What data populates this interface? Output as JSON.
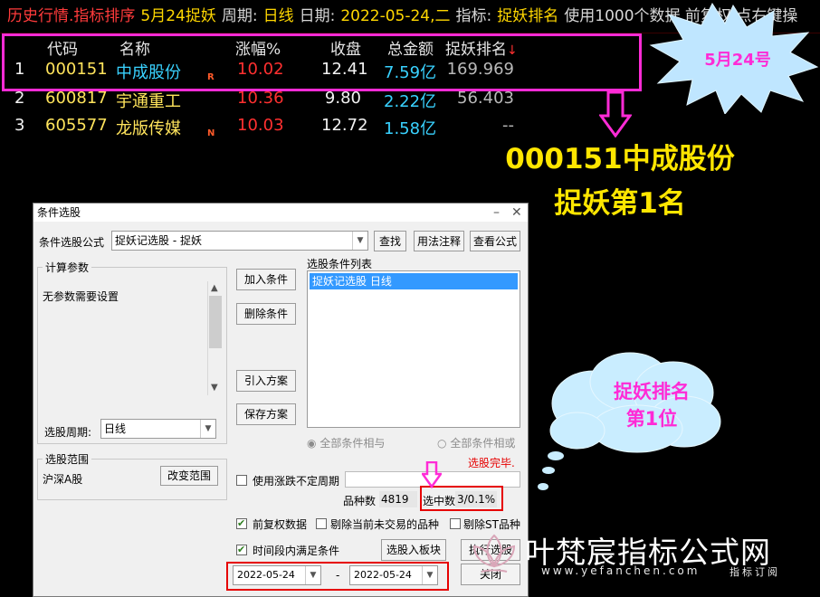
{
  "topbar": {
    "segments": [
      {
        "text": "历史行情.指标排序",
        "color": "#ff3b3b"
      },
      {
        "text": "5月24捉妖",
        "color": "#ffd700"
      },
      {
        "text": "周期:",
        "color": "#d6d6d6"
      },
      {
        "text": "日线",
        "color": "#ffd700"
      },
      {
        "text": "日期:",
        "color": "#d6d6d6"
      },
      {
        "text": "2022-05-24,二",
        "color": "#ffd700"
      },
      {
        "text": "指标:",
        "color": "#d6d6d6"
      },
      {
        "text": "捉妖排名",
        "color": "#ffd700"
      },
      {
        "text": "使用1000个数据 前复权 点右键操",
        "color": "#d6d6d6"
      }
    ]
  },
  "table": {
    "headers": {
      "code": "代码",
      "name": "名称",
      "change": "涨幅%",
      "close": "收盘",
      "amount": "总金额",
      "rank": "捉妖排名",
      "sort_arrow": "↓"
    },
    "rows": [
      {
        "idx": "1",
        "code": "000151",
        "name": "中成股份",
        "tag": "R",
        "change": "10.02",
        "close": "12.41",
        "amount": "7.59亿",
        "rank": "169.969"
      },
      {
        "idx": "2",
        "code": "600817",
        "name": "宇通重工",
        "tag": "",
        "change": "10.36",
        "close": "9.80",
        "amount": "2.22亿",
        "rank": "56.403"
      },
      {
        "idx": "3",
        "code": "605577",
        "name": "龙版传媒",
        "tag": "N",
        "change": "10.03",
        "close": "12.72",
        "amount": "1.58亿",
        "rank": "--"
      }
    ]
  },
  "annotations": {
    "star_text": "5月24号",
    "big_line1": "000151中成股份",
    "big_line2": "捉妖第1名",
    "cloud_line1": "捉妖排名",
    "cloud_line2": "第1位",
    "accent_magenta": "#ff2bd6",
    "accent_yellow": "#ffe600"
  },
  "dialog": {
    "title": "条件选股",
    "formula_label": "条件选股公式",
    "formula_value": "捉妖记选股   - 捉妖",
    "btn_find": "查找",
    "btn_usage": "用法注释",
    "btn_view": "查看公式",
    "params_group": "计算参数",
    "params_text": "无参数需要设置",
    "period_label": "选股周期:",
    "period_value": "日线",
    "btn_add": "加入条件",
    "btn_delete": "删除条件",
    "btn_import": "引入方案",
    "btn_save": "保存方案",
    "list_label": "选股条件列表",
    "list_items": [
      "捉妖记选股  日线"
    ],
    "radio_and": "全部条件相与",
    "radio_or": "全部条件相或",
    "scope_group": "选股范围",
    "scope_value": "沪深A股",
    "btn_scope": "改变范围",
    "status": "选股完毕.",
    "chk_uncertain": "使用涨跌不定周期",
    "count_label": "品种数",
    "count_value": "4819",
    "selected_label": "选中数",
    "selected_value": "3/0.1%",
    "chk_adjust": "前复权数据",
    "chk_exclude_notrade": "剔除当前未交易的品种",
    "chk_exclude_st": "剔除ST品种",
    "chk_period": "时间段内满足条件",
    "btn_to_block": "选股入板块",
    "btn_execute": "执行选股",
    "date_from": "2022-05-24",
    "date_sep": "-",
    "date_to": "2022-05-24",
    "btn_close": "关闭"
  },
  "watermark": {
    "title": "叶梵宸指标公式网",
    "url": "www.yefanchen.com",
    "subtitle": "指标订阅"
  }
}
